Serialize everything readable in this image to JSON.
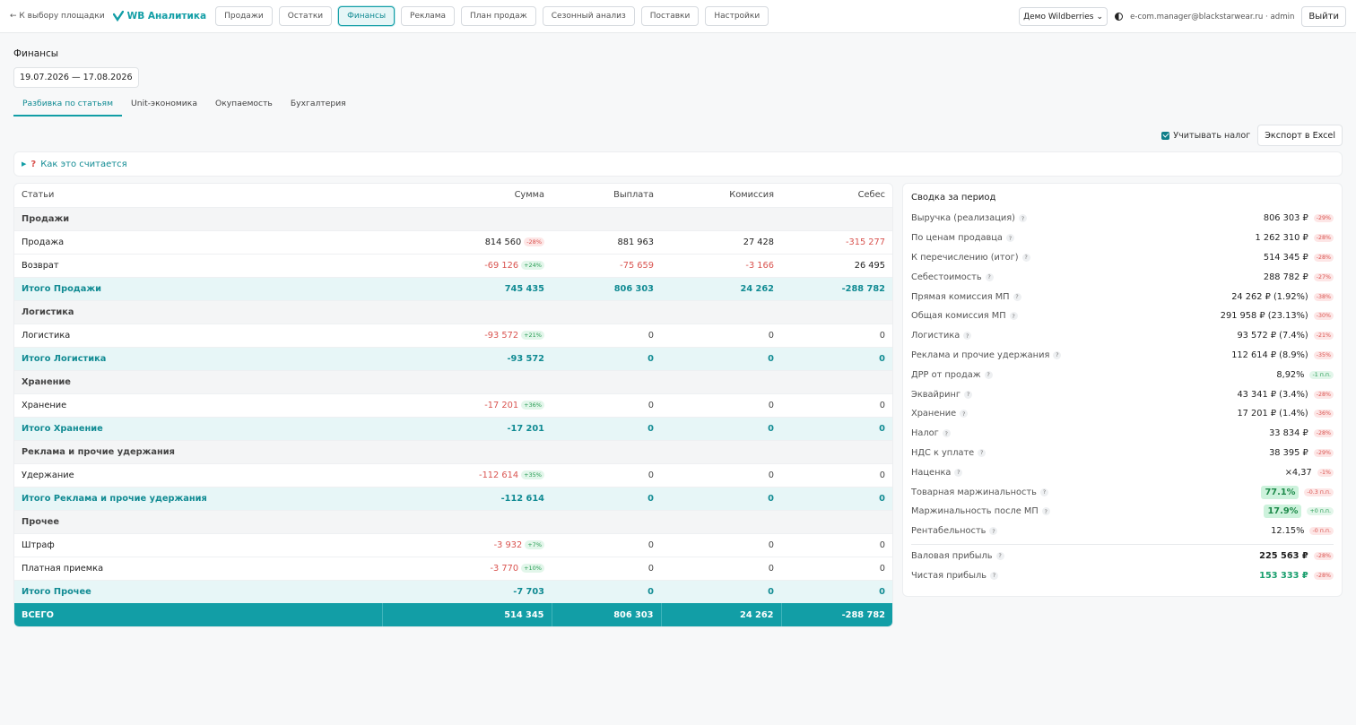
{
  "header": {
    "back_link": "← К выбору площадки",
    "logo_text": "WB Аналитика",
    "nav": [
      "Продажи",
      "Остатки",
      "Финансы",
      "Реклама",
      "План продаж",
      "Сезонный анализ",
      "Поставки",
      "Настройки"
    ],
    "active_nav": "Финансы",
    "store_select": "Демо Wildberries",
    "user": "e-com.manager@blackstarwear.ru · admin",
    "logout": "Выйти"
  },
  "page": {
    "title": "Финансы",
    "date_range": "19.07.2026 — 17.08.2026",
    "tabs": [
      "Разбивка по статьям",
      "Unit-экономика",
      "Окупаемость",
      "Бухгалтерия"
    ],
    "tax_checkbox_label": "Учитывать налог",
    "tax_checked": true,
    "export_label": "Экспорт в Excel",
    "how_label": "Как это считается"
  },
  "table": {
    "columns": [
      "Статьи",
      "Сумма",
      "Выплата",
      "Комиссия",
      "Себес"
    ],
    "rows": [
      {
        "type": "section",
        "label": "Продажи"
      },
      {
        "type": "row",
        "label": "Продажа",
        "sum": "814 560",
        "badge": "-28%",
        "badge_tone": "red",
        "sum_tone": "",
        "payout": "881 963",
        "payout_tone": "",
        "commission": "27 428",
        "commission_tone": "",
        "cost": "-315 277",
        "cost_tone": "neg"
      },
      {
        "type": "row",
        "label": "Возврат",
        "sum": "-69 126",
        "badge": "+24%",
        "badge_tone": "green",
        "sum_tone": "neg",
        "payout": "-75 659",
        "payout_tone": "neg",
        "commission": "-3 166",
        "commission_tone": "neg",
        "cost": "26 495",
        "cost_tone": ""
      },
      {
        "type": "total",
        "label": "Итого Продажи",
        "sum": "745 435",
        "payout": "806 303",
        "commission": "24 262",
        "cost": "-288 782"
      },
      {
        "type": "section",
        "label": "Логистика"
      },
      {
        "type": "row",
        "label": "Логистика",
        "sum": "-93 572",
        "badge": "+21%",
        "badge_tone": "green",
        "sum_tone": "neg",
        "payout": "0",
        "payout_tone": "zero",
        "commission": "0",
        "commission_tone": "zero",
        "cost": "0",
        "cost_tone": "zero"
      },
      {
        "type": "total",
        "label": "Итого Логистика",
        "sum": "-93 572",
        "payout": "0",
        "commission": "0",
        "cost": "0"
      },
      {
        "type": "section",
        "label": "Хранение"
      },
      {
        "type": "row",
        "label": "Хранение",
        "sum": "-17 201",
        "badge": "+36%",
        "badge_tone": "green",
        "sum_tone": "neg",
        "payout": "0",
        "payout_tone": "zero",
        "commission": "0",
        "commission_tone": "zero",
        "cost": "0",
        "cost_tone": "zero"
      },
      {
        "type": "total",
        "label": "Итого Хранение",
        "sum": "-17 201",
        "payout": "0",
        "commission": "0",
        "cost": "0"
      },
      {
        "type": "section",
        "label": "Реклама и прочие удержания"
      },
      {
        "type": "row",
        "label": "Удержание",
        "sum": "-112 614",
        "badge": "+35%",
        "badge_tone": "green",
        "sum_tone": "neg",
        "payout": "0",
        "payout_tone": "zero",
        "commission": "0",
        "commission_tone": "zero",
        "cost": "0",
        "cost_tone": "zero"
      },
      {
        "type": "total",
        "label": "Итого Реклама и прочие удержания",
        "sum": "-112 614",
        "payout": "0",
        "commission": "0",
        "cost": "0"
      },
      {
        "type": "section",
        "label": "Прочее"
      },
      {
        "type": "row",
        "label": "Штраф",
        "sum": "-3 932",
        "badge": "+7%",
        "badge_tone": "green",
        "sum_tone": "neg",
        "payout": "0",
        "payout_tone": "zero",
        "commission": "0",
        "commission_tone": "zero",
        "cost": "0",
        "cost_tone": "zero"
      },
      {
        "type": "row",
        "label": "Платная приемка",
        "sum": "-3 770",
        "badge": "+10%",
        "badge_tone": "green",
        "sum_tone": "neg",
        "payout": "0",
        "payout_tone": "zero",
        "commission": "0",
        "commission_tone": "zero",
        "cost": "0",
        "cost_tone": "zero"
      },
      {
        "type": "total",
        "label": "Итого Прочее",
        "sum": "-7 703",
        "payout": "0",
        "commission": "0",
        "cost": "0"
      },
      {
        "type": "grand",
        "label": "ВСЕГО",
        "sum": "514 345",
        "payout": "806 303",
        "commission": "24 262",
        "cost": "-288 782"
      }
    ]
  },
  "summary": {
    "title": "Сводка за период",
    "rows": [
      {
        "label": "Выручка (реализация)",
        "value": "806 303 ₽",
        "badge": "-29%",
        "badge_tone": "red"
      },
      {
        "label": "По ценам продавца",
        "value": "1 262 310 ₽",
        "badge": "-28%",
        "badge_tone": "red"
      },
      {
        "label": "К перечислению (итог)",
        "value": "514 345 ₽",
        "badge": "-28%",
        "badge_tone": "red"
      },
      {
        "label": "Себестоимость",
        "value": "288 782 ₽",
        "badge": "-27%",
        "badge_tone": "red"
      },
      {
        "label": "Прямая комиссия МП",
        "value": "24 262 ₽ (1.92%)",
        "badge": "-38%",
        "badge_tone": "red"
      },
      {
        "label": "Общая комиссия МП",
        "value": "291 958 ₽ (23.13%)",
        "badge": "-30%",
        "badge_tone": "red"
      },
      {
        "label": "Логистика",
        "value": "93 572 ₽ (7.4%)",
        "badge": "-21%",
        "badge_tone": "red"
      },
      {
        "label": "Реклама и прочие удержания",
        "value": "112 614 ₽ (8.9%)",
        "badge": "-35%",
        "badge_tone": "red"
      },
      {
        "label": "ДРР от продаж",
        "value": "8,92%",
        "badge": "-1 п.п.",
        "badge_tone": "green"
      },
      {
        "label": "Эквайринг",
        "value": "43 341 ₽ (3.4%)",
        "badge": "-28%",
        "badge_tone": "red"
      },
      {
        "label": "Хранение",
        "value": "17 201 ₽ (1.4%)",
        "badge": "-36%",
        "badge_tone": "red"
      },
      {
        "label": "Налог",
        "value": "33 834 ₽",
        "badge": "-28%",
        "badge_tone": "red"
      },
      {
        "label": "НДС к уплате",
        "value": "38 395 ₽",
        "badge": "-29%",
        "badge_tone": "red"
      },
      {
        "label": "Наценка",
        "value": "×4,37",
        "badge": "-1%",
        "badge_tone": "red"
      },
      {
        "label": "Товарная маржинальность",
        "value": "77.1%",
        "badge": "-0.3 п.п.",
        "badge_tone": "red",
        "highlight": true
      },
      {
        "label": "Маржинальность после МП",
        "value": "17.9%",
        "badge": "+0 п.п.",
        "badge_tone": "green",
        "highlight": true
      },
      {
        "label": "Рентабельность",
        "value": "12.15%",
        "badge": "-0 п.п.",
        "badge_tone": "red"
      }
    ],
    "footer_rows": [
      {
        "label": "Валовая прибыль",
        "value": "225 563 ₽",
        "badge": "-28%",
        "badge_tone": "red",
        "style": "bold"
      },
      {
        "label": "Чистая прибыль",
        "value": "153 333 ₽",
        "badge": "-28%",
        "badge_tone": "red",
        "style": "teal"
      }
    ]
  },
  "colors": {
    "accent": "#129ea6",
    "negative": "#d9534f",
    "positive": "#2a9d55"
  }
}
